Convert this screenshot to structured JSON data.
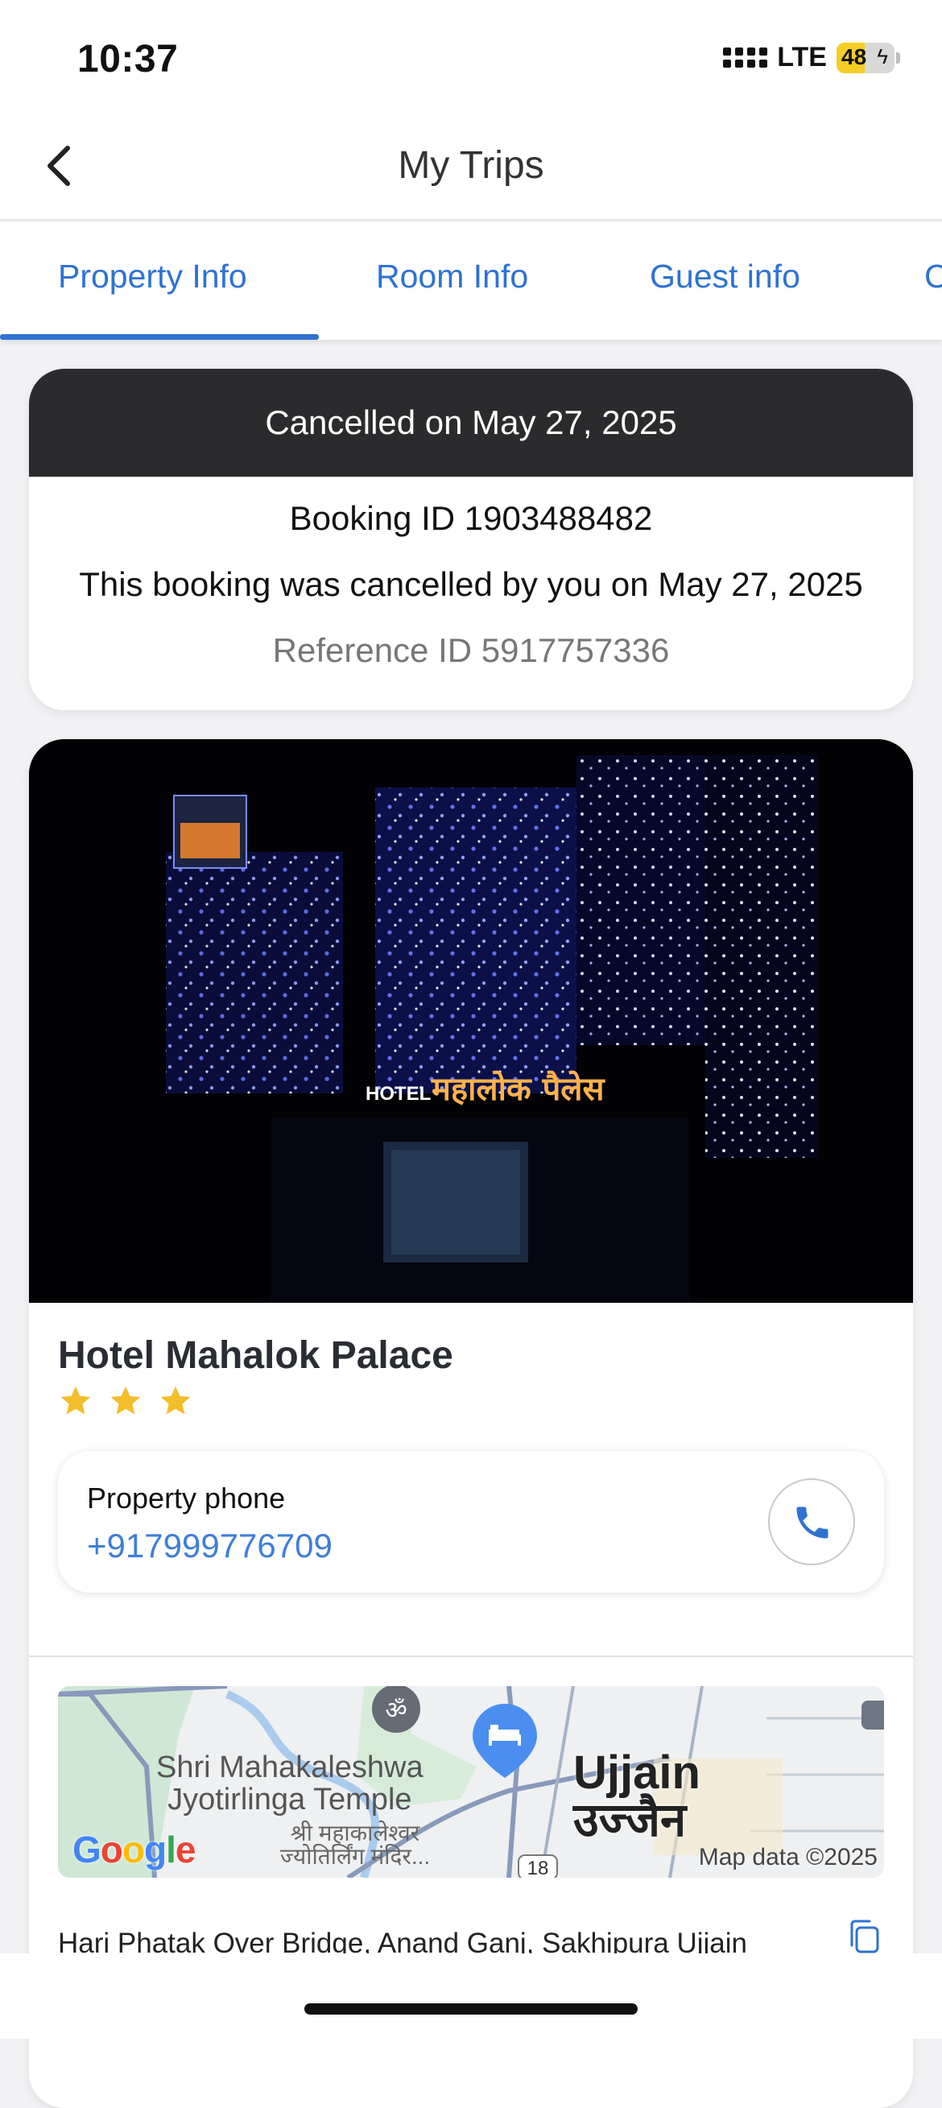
{
  "status_bar": {
    "time": "10:37",
    "network": "LTE",
    "battery": "48",
    "battery_level": 0.48
  },
  "nav": {
    "title": "My Trips"
  },
  "tabs": [
    {
      "label": "Property Info",
      "active": true
    },
    {
      "label": "Room Info",
      "active": false
    },
    {
      "label": "Guest info",
      "active": false
    },
    {
      "label": "C",
      "active": false
    }
  ],
  "cancellation": {
    "header": "Cancelled on May 27, 2025",
    "booking_id": "Booking ID 1903488482",
    "message": "This booking was cancelled by you on May 27, 2025",
    "reference_id": "Reference ID 5917757336"
  },
  "hotel": {
    "name": "Hotel Mahalok Palace",
    "stars": 3,
    "sign_text": "HOTEL",
    "sign_devanagari": "महालोक पैलेस",
    "phone_label": "Property phone",
    "phone": "+917999776709",
    "address": "Hari Phatak Over Bridge, Anand Ganj, Sakhipura Ujjain"
  },
  "map": {
    "place_line1": "Shri Mahakaleshwa",
    "place_line2": "Jyotirlinga Temple",
    "place_dev_line1": "श्री महाकालेश्वर",
    "place_dev_line2": "ज्योतिर्लिंग मंदिर...",
    "city": "Ujjain",
    "city_dev": "उज्जैन",
    "road_number": "18",
    "attribution": "Map data ©2025",
    "logo": {
      "g": "G",
      "o1": "o",
      "o2": "o",
      "g2": "g",
      "l": "l",
      "e": "e"
    }
  },
  "colors": {
    "accent": "#2e72d2",
    "star": "#f3be2b",
    "header_dark": "#2b2b2d"
  }
}
